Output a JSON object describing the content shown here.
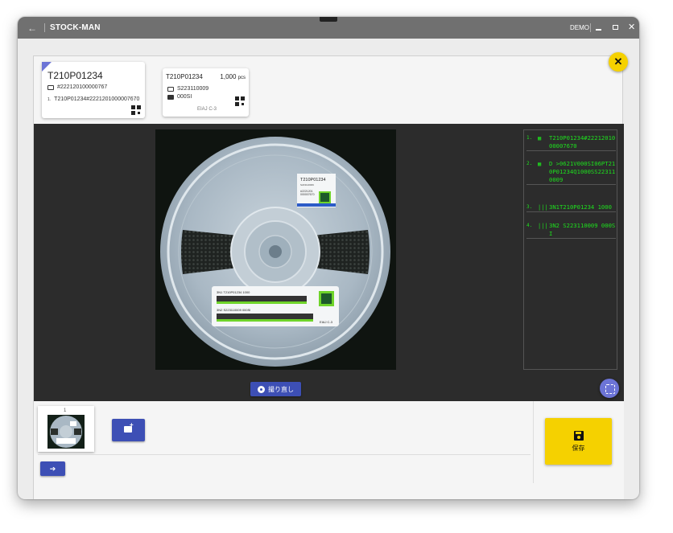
{
  "window": {
    "title": "STOCK-MAN",
    "user": "DEMO"
  },
  "label_card": {
    "part_no": "T210P01234",
    "serial": "#222120100000767",
    "code_index": "1.",
    "code_value": "T210P01234#2221201000007670"
  },
  "reel_card": {
    "part_no": "T210P01234",
    "quantity": "1,000",
    "unit": "pcs",
    "lot": "S223110009",
    "sub": "000SI",
    "standard": "EIAJ C-3"
  },
  "photo_label": {
    "top_part": "T210P01234",
    "top_line2": "S223110009",
    "top_line3": "#2221201",
    "top_line4": "000007670",
    "bar1": "3N1 T210P01234 1000",
    "bar2": "3N2 S223110009 000SI",
    "eiaj": "EIAJ C-3"
  },
  "scan_results": [
    {
      "index": "1.",
      "kind": "qr-icon",
      "value": "T210P01234#2221201000007670"
    },
    {
      "index": "2.",
      "kind": "qr-icon",
      "value": "D >0621V000SI06PT210P01234Q1000SS223110009"
    },
    {
      "index": "3.",
      "kind": "barcode-icon",
      "value": "3N1T210P01234 1000"
    },
    {
      "index": "4.",
      "kind": "barcode-icon",
      "value": "3N2 S223110009 000SI"
    }
  ],
  "buttons": {
    "retake": "撮り直し",
    "save": "保存"
  },
  "thumbnails": [
    {
      "number": "1"
    }
  ]
}
